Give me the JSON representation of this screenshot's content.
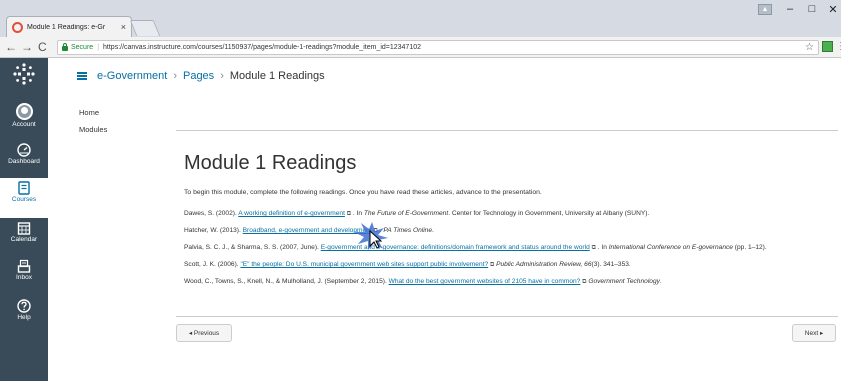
{
  "browser": {
    "tab_title": "Module 1 Readings: e-Gr",
    "tab_close": "×",
    "user_badge": "▲",
    "minimize": "–",
    "maximize": "□",
    "close": "✕",
    "back": "←",
    "forward": "→",
    "reload": "C",
    "secure_label": "Secure",
    "separator": "|",
    "url": "https://canvas.instructure.com/courses/1150937/pages/module-1-readings?module_item_id=12347102",
    "bookmark": "☆",
    "menu": "⋮"
  },
  "globalnav": {
    "items": [
      {
        "label": "Account",
        "icon": "account-avatar"
      },
      {
        "label": "Dashboard",
        "icon": "dashboard-icon"
      },
      {
        "label": "Courses",
        "icon": "courses-icon"
      },
      {
        "label": "Calendar",
        "icon": "calendar-icon"
      },
      {
        "label": "Inbox",
        "icon": "inbox-icon"
      },
      {
        "label": "Help",
        "icon": "help-icon"
      }
    ],
    "active": "Courses"
  },
  "breadcrumb": {
    "course": "e-Government",
    "sep1": "›",
    "pages": "Pages",
    "sep2": "›",
    "current": "Module 1 Readings"
  },
  "coursenav": {
    "home": "Home",
    "modules": "Modules"
  },
  "page": {
    "title": "Module 1 Readings",
    "intro": "To begin this module, complete the following readings. Once you have read these articles, advance to the presentation.",
    "citations": [
      {
        "pre": "Dawes, S. (2002). ",
        "link": "A working definition of e-government",
        "ext": "⧉",
        "mid": " . In ",
        "ital": "The Future of E-Government",
        "post": ". Center for Technology in Government, University at Albany (SUNY)."
      },
      {
        "pre": "Hatcher, W. (2013). ",
        "link": "Broadband, e-government and development",
        "ext": "⧉",
        "mid": " . ",
        "ital": "PA Times Online",
        "post": "."
      },
      {
        "pre": "Palvia, S. C. J., & Sharma, S. S. (2007, June). ",
        "link": "E-government and e-governance: definitions/domain framework and status around the world",
        "ext": "⧉",
        "mid": " . In ",
        "ital": "International Conference on E-governance",
        "post": " (pp. 1–12)."
      },
      {
        "pre": "Scott, J. K. (2006). ",
        "link": "\"E\" the people: Do U.S. municipal government web sites support public involvement?",
        "ext": "⧉",
        "mid": " ",
        "ital": "Public Administration Review, 66",
        "post": "(3). 341–353."
      },
      {
        "pre": "Wood, C., Towns, S., Knell, N., & Mulholland, J. (September 2, 2015). ",
        "link": "What do the best government websites of 2105 have in common?",
        "ext": "⧉",
        "mid": " ",
        "ital": "Government Technology",
        "post": "."
      }
    ]
  },
  "pagination": {
    "previous": "◂ Previous",
    "next": "Next ▸"
  },
  "colors": {
    "nav_bg": "#394b58",
    "link": "#0770a3",
    "secure": "#1a8a34"
  }
}
